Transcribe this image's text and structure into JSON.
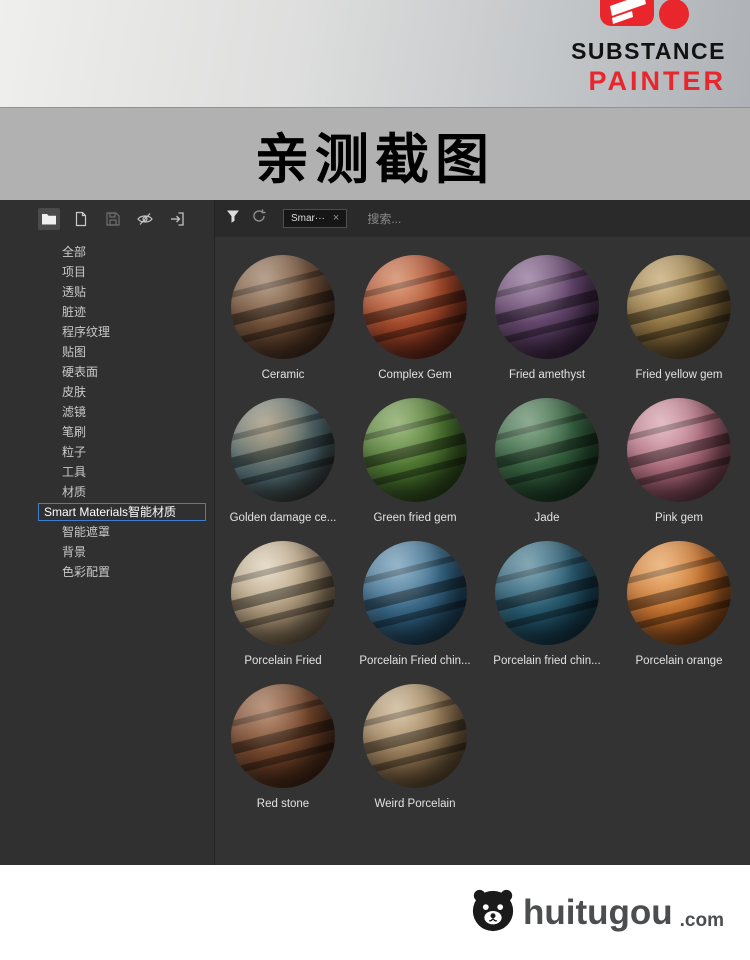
{
  "banner": {
    "brand_line1": "SUBSTANCE",
    "brand_line2": "PAINTER",
    "accent_color": "#e8262c"
  },
  "headline": {
    "text": "亲测截图"
  },
  "sidebar": {
    "toolbar_icons": [
      "folder-icon",
      "new-file-icon",
      "save-icon",
      "eye-slash-icon",
      "export-icon"
    ],
    "categories": [
      {
        "label": "全部",
        "selected": false
      },
      {
        "label": "项目",
        "selected": false
      },
      {
        "label": "透贴",
        "selected": false
      },
      {
        "label": "脏迹",
        "selected": false
      },
      {
        "label": "程序纹理",
        "selected": false
      },
      {
        "label": "贴图",
        "selected": false
      },
      {
        "label": "硬表面",
        "selected": false
      },
      {
        "label": "皮肤",
        "selected": false
      },
      {
        "label": "滤镜",
        "selected": false
      },
      {
        "label": "笔刷",
        "selected": false
      },
      {
        "label": "粒子",
        "selected": false
      },
      {
        "label": "工具",
        "selected": false
      },
      {
        "label": "材质",
        "selected": false
      },
      {
        "label": "Smart Materials智能材质",
        "selected": true
      },
      {
        "label": "智能遮罩",
        "selected": false
      },
      {
        "label": "背景",
        "selected": false
      },
      {
        "label": "色彩配置",
        "selected": false
      }
    ]
  },
  "filter_bar": {
    "token_label": "Smar···",
    "token_close": "×",
    "search_placeholder": "搜索..."
  },
  "materials": [
    {
      "name": "Ceramic",
      "colors": [
        "#9a7a5e",
        "#6b4a33",
        "#2e1d12"
      ]
    },
    {
      "name": "Complex Gem",
      "colors": [
        "#cf7a4e",
        "#a04226",
        "#3f1510"
      ]
    },
    {
      "name": "Fried amethyst",
      "colors": [
        "#8a6a92",
        "#5d3f66",
        "#241528"
      ]
    },
    {
      "name": "Fried yellow gem",
      "colors": [
        "#c2a468",
        "#8a6e3e",
        "#3a2c14"
      ]
    },
    {
      "name": "Golden damage ce...",
      "colors": [
        "#9a8a6a",
        "#4f6b72",
        "#2a2018"
      ]
    },
    {
      "name": "Green fried gem",
      "colors": [
        "#7aa052",
        "#47702c",
        "#1b2e0f"
      ]
    },
    {
      "name": "Jade",
      "colors": [
        "#5c8a62",
        "#2f5a3a",
        "#102616"
      ]
    },
    {
      "name": "Pink gem",
      "colors": [
        "#d9a3af",
        "#a86476",
        "#4a2430"
      ]
    },
    {
      "name": "Porcelain Fried",
      "colors": [
        "#ded0b4",
        "#a89274",
        "#4f4230"
      ]
    },
    {
      "name": "Porcelain Fried chin...",
      "colors": [
        "#6a98b5",
        "#2f5f7f",
        "#10293a"
      ]
    },
    {
      "name": "Porcelain fried chin...",
      "colors": [
        "#4f8396",
        "#22546b",
        "#0c2430"
      ]
    },
    {
      "name": "Porcelain orange",
      "colors": [
        "#e8a055",
        "#c06a28",
        "#5a2c0c"
      ]
    },
    {
      "name": "Red stone",
      "colors": [
        "#a06a48",
        "#6b3f26",
        "#2a160c"
      ]
    },
    {
      "name": "Weird Porcelain",
      "colors": [
        "#c9b088",
        "#8f7350",
        "#40301c"
      ]
    }
  ],
  "footer": {
    "logo_text": "huitugou",
    "logo_suffix": ".com"
  }
}
